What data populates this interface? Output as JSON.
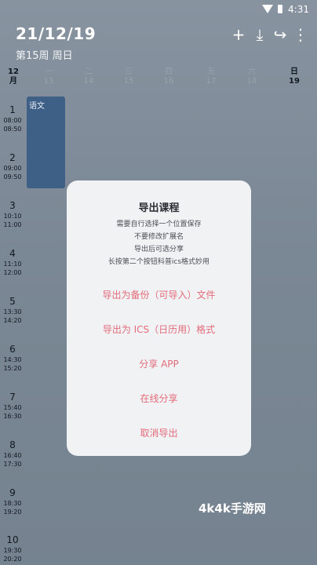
{
  "status_bar": {
    "time": "4:31"
  },
  "header": {
    "date": "21/12/19",
    "week_info": "第15周   周日"
  },
  "toolbar": {
    "add": "+",
    "download": "⤓",
    "share": "↪",
    "more": "⋮"
  },
  "calendar": {
    "month_num": "12",
    "month_unit": "月",
    "days": [
      {
        "name": "一",
        "date": "13"
      },
      {
        "name": "二",
        "date": "14"
      },
      {
        "name": "三",
        "date": "15"
      },
      {
        "name": "四",
        "date": "16"
      },
      {
        "name": "五",
        "date": "17"
      },
      {
        "name": "六",
        "date": "18"
      },
      {
        "name": "日",
        "date": "19"
      }
    ],
    "periods": [
      {
        "num": "1",
        "start": "08:00",
        "end": "08:50"
      },
      {
        "num": "2",
        "start": "09:00",
        "end": "09:50"
      },
      {
        "num": "3",
        "start": "10:10",
        "end": "11:00"
      },
      {
        "num": "4",
        "start": "11:10",
        "end": "12:00"
      },
      {
        "num": "5",
        "start": "13:30",
        "end": "14:20"
      },
      {
        "num": "6",
        "start": "14:30",
        "end": "15:20"
      },
      {
        "num": "7",
        "start": "15:40",
        "end": "16:30"
      },
      {
        "num": "8",
        "start": "16:40",
        "end": "17:30"
      },
      {
        "num": "9",
        "start": "18:30",
        "end": "19:20"
      },
      {
        "num": "10",
        "start": "19:30",
        "end": "20:20"
      }
    ],
    "course": {
      "name": "语文"
    }
  },
  "dialog": {
    "title": "导出课程",
    "lines": [
      "需要自行选择一个位置保存",
      "不要修改扩展名",
      "导出后可选分享",
      "长按第二个按钮科普ics格式妙用"
    ],
    "options": [
      "导出为备份（可导入）文件",
      "导出为 ICS（日历用）格式",
      "分享 APP",
      "在线分享",
      "取消导出"
    ]
  },
  "watermark": "4k4k手游网"
}
